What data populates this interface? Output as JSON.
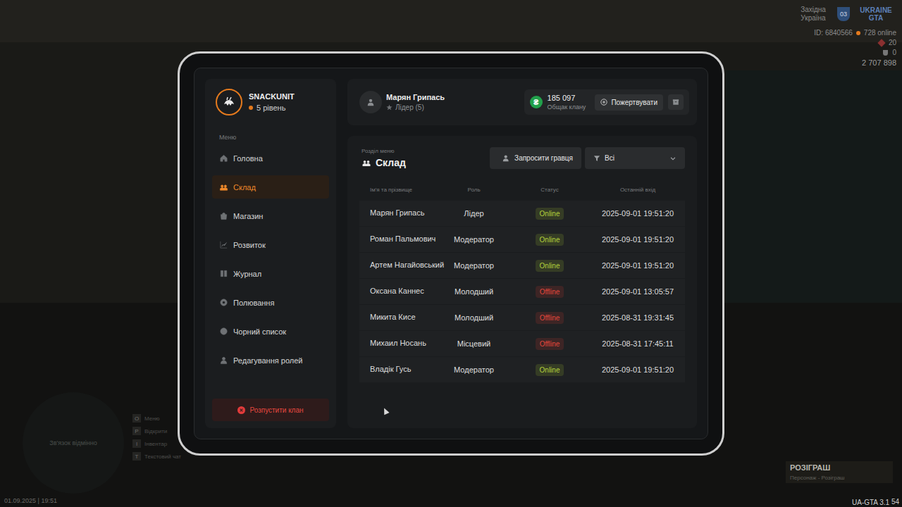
{
  "hud": {
    "region": "Західна Україна",
    "region_badge": "03",
    "logo": "UKRAINE GTA",
    "player_id": "ID: 6840566",
    "online": "728 online",
    "health": "20",
    "armor": "0",
    "money": "2 707 898",
    "minimap_text": "Зв'язок відмінно",
    "datetime": "01.09.2025 | 19:51",
    "version": "UA-GTA 3.1",
    "fps": "54",
    "giveaway": {
      "title": "РОЗІГРАШ",
      "subtitle": "Персонаж - Розіграш"
    },
    "hints": [
      {
        "key": "O",
        "label": "Меню"
      },
      {
        "key": "P",
        "label": "Відкрити"
      },
      {
        "key": "I",
        "label": "Інвентар"
      },
      {
        "key": "T",
        "label": "Текстовий чат"
      }
    ]
  },
  "clan": {
    "name": "SNACKUNIT",
    "level": "5 рівень"
  },
  "menu": {
    "label": "Меню",
    "items": [
      {
        "label": "Головна",
        "selected": false
      },
      {
        "label": "Склад",
        "selected": true
      },
      {
        "label": "Магазин",
        "selected": false
      },
      {
        "label": "Розвиток",
        "selected": false
      },
      {
        "label": "Журнал",
        "selected": false
      },
      {
        "label": "Полювання",
        "selected": false
      },
      {
        "label": "Чорний список",
        "selected": false
      },
      {
        "label": "Редагування ролей",
        "selected": false
      }
    ]
  },
  "disband_button": "Розпустити клан",
  "user": {
    "name": "Марян Грипась",
    "rank": "Лідер (5)"
  },
  "treasury": {
    "coin": "₴",
    "amount": "185 097",
    "label": "Общак клану",
    "donate_button": "Пожертвувати"
  },
  "section": {
    "caption": "Розділ меню",
    "title": "Склад"
  },
  "invite_button": "Запросити гравця",
  "filter": {
    "value": "Всі"
  },
  "table": {
    "columns": [
      "Ім'я та прізвище",
      "Роль",
      "Статус",
      "Останній вхід"
    ],
    "rows": [
      {
        "name": "Марян Грипась",
        "role": "Лідер",
        "status": "Online",
        "last_login": "2025-09-01 19:51:20",
        "color": "#b4d23c"
      },
      {
        "name": "Роман Пальмович",
        "role": "Модератор",
        "status": "Online",
        "last_login": "2025-09-01 19:51:20",
        "color": "#b4d23c"
      },
      {
        "name": "Артем Нагайовський",
        "role": "Модератор",
        "status": "Online",
        "last_login": "2025-09-01 19:51:20",
        "color": "#b4d23c"
      },
      {
        "name": "Оксана Каннес",
        "role": "Молодший",
        "status": "Offline",
        "last_login": "2025-09-01 13:05:57",
        "color": "#e2473c"
      },
      {
        "name": "Микита Кисе",
        "role": "Молодший",
        "status": "Offline",
        "last_login": "2025-08-31 19:31:45",
        "color": "#e2473c"
      },
      {
        "name": "Михаил Носань",
        "role": "Місцевий",
        "status": "Offline",
        "last_login": "2025-08-31 17:45:11",
        "color": "#e2473c"
      },
      {
        "name": "Владік Гусь",
        "role": "Модератор",
        "status": "Online",
        "last_login": "2025-09-01 19:51:20",
        "color": "#b4d23c"
      }
    ]
  }
}
